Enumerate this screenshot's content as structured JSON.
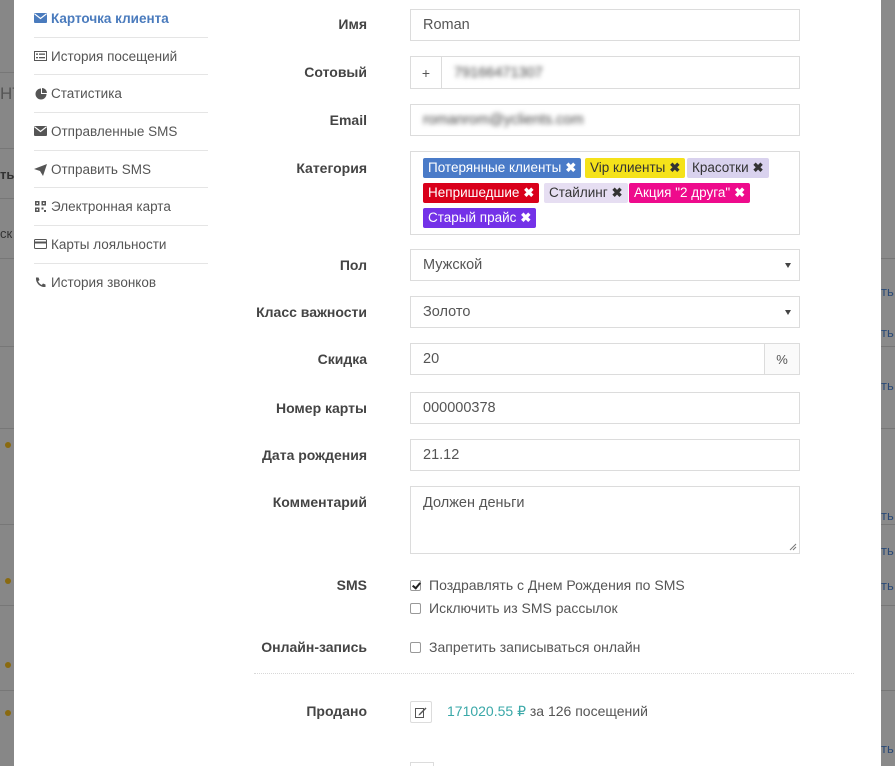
{
  "background": {
    "left_fragments": [
      {
        "text": "НТ"
      },
      {
        "text": "ть"
      },
      {
        "text": "ск"
      }
    ],
    "right_fragments": [
      {
        "text": "ть"
      },
      {
        "text": "ть"
      },
      {
        "text": "ть"
      },
      {
        "text": "ть"
      },
      {
        "text": "ть"
      },
      {
        "text": "ть"
      },
      {
        "text": "ть"
      }
    ]
  },
  "sidebar": {
    "items": [
      {
        "label": "Карточка клиента",
        "icon": "envelope-icon",
        "active": true
      },
      {
        "label": "История посещений",
        "icon": "list-icon",
        "active": false
      },
      {
        "label": "Статистика",
        "icon": "pie-chart-icon",
        "active": false
      },
      {
        "label": "Отправленные SMS",
        "icon": "envelope-icon",
        "active": false
      },
      {
        "label": "Отправить SMS",
        "icon": "send-icon",
        "active": false
      },
      {
        "label": "Электронная карта",
        "icon": "qrcode-icon",
        "active": false
      },
      {
        "label": "Карты лояльности",
        "icon": "credit-card-icon",
        "active": false
      },
      {
        "label": "История звонков",
        "icon": "phone-icon",
        "active": false
      }
    ]
  },
  "form": {
    "name_label": "Имя",
    "name_value": "Roman",
    "phone_label": "Сотовый",
    "phone_prefix": "+",
    "phone_value": "79166471307",
    "email_label": "Email",
    "email_value": "romanrom@yclients.com",
    "category_label": "Категория",
    "categories": [
      {
        "label": "Потерянные клиенты",
        "bg": "#4a7bc8",
        "fg": "#ffffff"
      },
      {
        "label": "Vip клиенты",
        "bg": "#f5e21a",
        "fg": "#333333"
      },
      {
        "label": "Красотки",
        "bg": "#d9d2ee",
        "fg": "#333333"
      },
      {
        "label": "Непришедшие",
        "bg": "#d9001b",
        "fg": "#ffffff"
      },
      {
        "label": "Стайлинг",
        "bg": "#e6def2",
        "fg": "#333333"
      },
      {
        "label": "Акция \"2 друга\"",
        "bg": "#ee0b8c",
        "fg": "#ffffff"
      },
      {
        "label": "Старый прайс",
        "bg": "#7432e8",
        "fg": "#ffffff"
      }
    ],
    "gender_label": "Пол",
    "gender_value": "Мужской",
    "importance_label": "Класс важности",
    "importance_value": "Золото",
    "discount_label": "Скидка",
    "discount_value": "20",
    "discount_unit": "%",
    "card_label": "Номер карты",
    "card_value": "000000378",
    "birth_label": "Дата рождения",
    "birth_value": "21.12",
    "comment_label": "Комментарий",
    "comment_value": "Должен деньги",
    "sms_label": "SMS",
    "sms_birthday_label": "Поздравлять с Днем Рождения по SMS",
    "sms_birthday_checked": true,
    "sms_exclude_label": "Исключить из SMS рассылок",
    "sms_exclude_checked": false,
    "online_label": "Онлайн-запись",
    "online_forbid_label": "Запретить записываться онлайн",
    "online_forbid_checked": false,
    "sold_label": "Продано",
    "sold_amount": "171020.55 ₽",
    "sold_suffix": "за 126 посещений"
  },
  "colors": {
    "accent": "#4a7bbd",
    "sold_amount": "#3aa8a8"
  }
}
